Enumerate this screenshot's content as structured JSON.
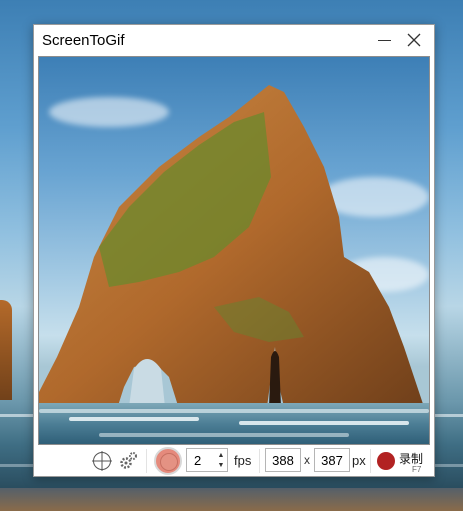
{
  "window": {
    "title": "ScreenToGif",
    "minimize_icon": "minimize-icon",
    "close_icon": "close-icon"
  },
  "toolbar": {
    "crosshair_icon": "crosshair-icon",
    "settings_icon": "gear-icon",
    "fps_value": "2",
    "fps_label": "fps",
    "width_value": "388",
    "times": "x",
    "height_value": "387",
    "px_label": "px",
    "record_label": "录制",
    "record_shortcut": "F7"
  },
  "colors": {
    "record": "#b22222",
    "record_toggle": "#e58a7c"
  }
}
